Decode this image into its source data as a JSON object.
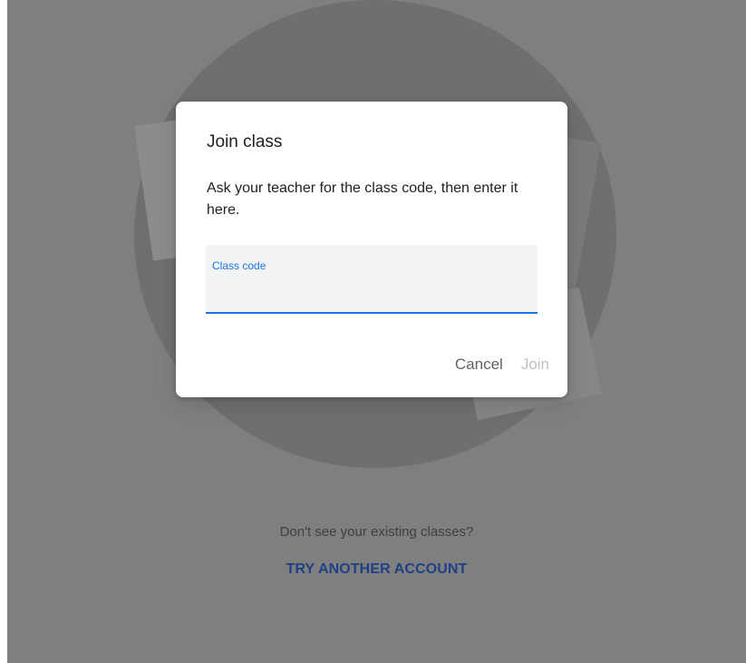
{
  "dialog": {
    "title": "Join class",
    "body": "Ask your teacher for the class code, then enter it here.",
    "field_label": "Class code",
    "field_value": "",
    "cancel_label": "Cancel",
    "join_label": "Join"
  },
  "background": {
    "help_text": "Don't see your existing classes?",
    "switch_account_label": "TRY ANOTHER ACCOUNT"
  },
  "colors": {
    "overlay": "#7f7f7f",
    "accent": "#1a73e8",
    "link": "#1f3f86",
    "disabled": "#bdc1c6"
  }
}
